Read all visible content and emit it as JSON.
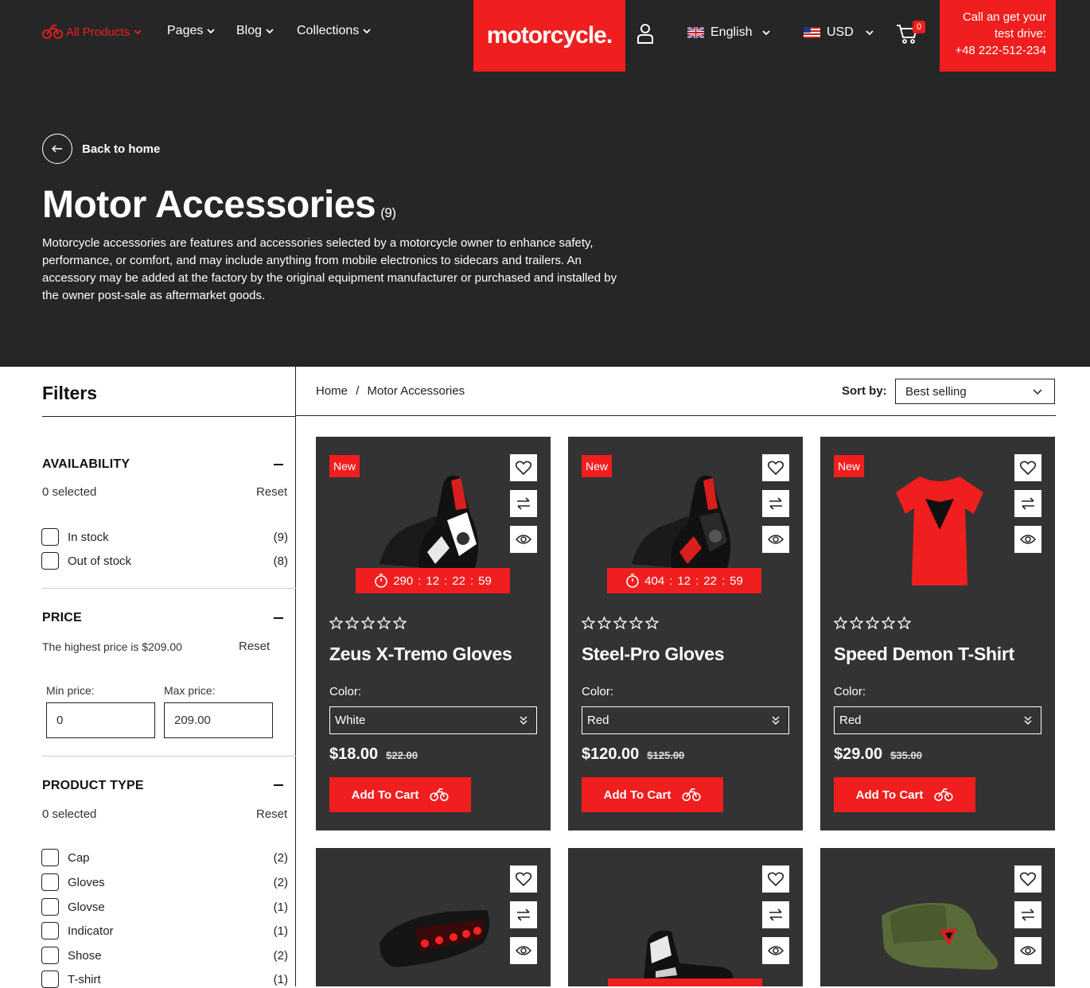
{
  "nav": {
    "all_products": "All Products",
    "pages": "Pages",
    "blog": "Blog",
    "collections": "Collections",
    "logo": "motorcycle.",
    "language": "English",
    "currency": "USD",
    "cart_count": "0",
    "call_line1": "Call an get your",
    "call_line2": "test drive:",
    "call_phone": "+48 222-512-234"
  },
  "hero": {
    "back_label": "Back to home",
    "title": "Motor Accessories",
    "count": "(9)",
    "description": "Motorcycle accessories are features and accessories selected by a motorcycle owner to enhance safety, performance, or comfort, and may include anything from mobile electronics to sidecars and trailers. An accessory may be added at the factory by the original equipment manufacturer or purchased and installed by the owner post-sale as aftermarket goods."
  },
  "filters": {
    "title": "Filters",
    "availability": {
      "heading": "AVAILABILITY",
      "selected": "0 selected",
      "reset": "Reset",
      "options": [
        {
          "label": "In stock",
          "count": "(9)"
        },
        {
          "label": "Out of stock",
          "count": "(8)"
        }
      ]
    },
    "price": {
      "heading": "PRICE",
      "highest": "The highest price is $209.00",
      "reset": "Reset",
      "min_label": "Min price:",
      "max_label": "Max price:",
      "min_value": "0",
      "max_value": "209.00"
    },
    "product_type": {
      "heading": "PRODUCT TYPE",
      "selected": "0 selected",
      "reset": "Reset",
      "options": [
        {
          "label": "Cap",
          "count": "(2)"
        },
        {
          "label": "Gloves",
          "count": "(2)"
        },
        {
          "label": "Glovse",
          "count": "(1)"
        },
        {
          "label": "Indicator",
          "count": "(1)"
        },
        {
          "label": "Shose",
          "count": "(2)"
        },
        {
          "label": "T-shirt",
          "count": "(1)"
        }
      ]
    }
  },
  "breadcrumb": {
    "home": "Home",
    "sep": "/",
    "current": "Motor Accessories"
  },
  "sort": {
    "label": "Sort by:",
    "value": "Best selling"
  },
  "products": [
    {
      "badge": "New",
      "timer": [
        "290",
        ":",
        "12",
        ":",
        "22",
        ":",
        "59"
      ],
      "name": "Zeus X-Tremo Gloves",
      "color_label": "Color:",
      "color": "White",
      "price": "$18.00",
      "old_price": "$22.00",
      "cta": "Add To Cart"
    },
    {
      "badge": "New",
      "timer": [
        "404",
        ":",
        "12",
        ":",
        "22",
        ":",
        "59"
      ],
      "name": "Steel-Pro Gloves",
      "color_label": "Color:",
      "color": "Red",
      "price": "$120.00",
      "old_price": "$125.00",
      "cta": "Add To Cart"
    },
    {
      "badge": "New",
      "name": "Speed Demon T-Shirt",
      "color_label": "Color:",
      "color": "Red",
      "price": "$29.00",
      "old_price": "$35.00",
      "cta": "Add To Cart"
    }
  ],
  "colors": {
    "accent": "#f01e1e",
    "dark": "#262626",
    "card": "#333333"
  }
}
